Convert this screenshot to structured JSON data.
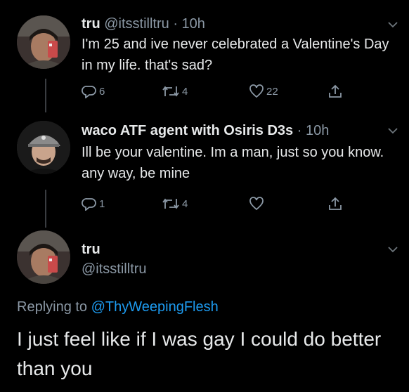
{
  "colors": {
    "background": "#000000",
    "text_primary": "#e7e9ea",
    "text_secondary": "#8b98a5",
    "link": "#1d9bf0",
    "thread_line": "#3a3d41"
  },
  "tweets": [
    {
      "name": "tru",
      "handle": "@itsstilltru",
      "time": "· 10h",
      "text": "I'm 25 and ive never celebrated a Valentine's Day in my life. that's sad?",
      "actions": {
        "reply_icon": "reply-icon",
        "reply_count": "6",
        "retweet_icon": "retweet-icon",
        "retweet_count": "4",
        "like_icon": "heart-icon",
        "like_count": "22",
        "share_icon": "share-icon"
      }
    },
    {
      "name": "waco ATF agent with Osiris D3s",
      "handle": "",
      "time": "· 10h",
      "text": "Ill be your valentine. Im a man, just so you know. any way, be mine",
      "actions": {
        "reply_icon": "reply-icon",
        "reply_count": "1",
        "retweet_icon": "retweet-icon",
        "retweet_count": "4",
        "like_icon": "heart-icon",
        "like_count": "",
        "share_icon": "share-icon"
      }
    }
  ],
  "main_tweet": {
    "name": "tru",
    "handle": "@itsstilltru",
    "replying_prefix": "Replying to ",
    "replying_mention": "@ThyWeepingFlesh",
    "text": "I just feel like if I was gay I could do better than you"
  }
}
